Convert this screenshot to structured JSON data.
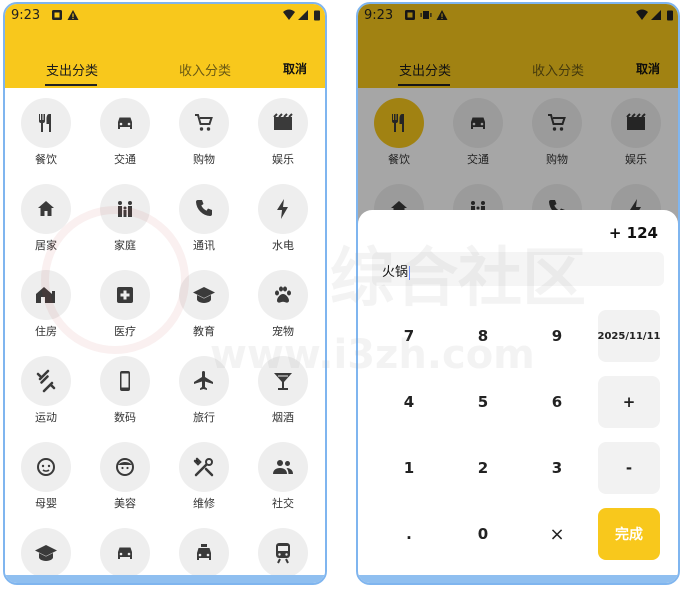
{
  "colors": {
    "accent": "#f8c81c",
    "phone_border": "#7fb5ef",
    "icon": "#3a3a3a",
    "circle_bg": "#eeeeee"
  },
  "status_bar": {
    "time": "9:23"
  },
  "tabs": {
    "expense": "支出分类",
    "income": "收入分类",
    "cancel": "取消"
  },
  "categories": [
    {
      "label": "餐饮",
      "icon": "restaurant-icon"
    },
    {
      "label": "交通",
      "icon": "car-icon"
    },
    {
      "label": "购物",
      "icon": "cart-icon"
    },
    {
      "label": "娱乐",
      "icon": "movie-icon"
    },
    {
      "label": "居家",
      "icon": "home-icon"
    },
    {
      "label": "家庭",
      "icon": "family-icon"
    },
    {
      "label": "通讯",
      "icon": "phone-icon"
    },
    {
      "label": "水电",
      "icon": "bolt-icon"
    },
    {
      "label": "住房",
      "icon": "house-icon"
    },
    {
      "label": "医疗",
      "icon": "medical-icon"
    },
    {
      "label": "教育",
      "icon": "school-icon"
    },
    {
      "label": "宠物",
      "icon": "paw-icon"
    },
    {
      "label": "运动",
      "icon": "fitness-icon"
    },
    {
      "label": "数码",
      "icon": "smartphone-icon"
    },
    {
      "label": "旅行",
      "icon": "airplane-icon"
    },
    {
      "label": "烟酒",
      "icon": "bar-icon"
    },
    {
      "label": "母婴",
      "icon": "baby-icon"
    },
    {
      "label": "美容",
      "icon": "face-icon"
    },
    {
      "label": "维修",
      "icon": "tools-icon"
    },
    {
      "label": "社交",
      "icon": "people-icon"
    },
    {
      "label": "",
      "icon": "school-icon"
    },
    {
      "label": "",
      "icon": "car-icon"
    },
    {
      "label": "",
      "icon": "taxi-icon"
    },
    {
      "label": "",
      "icon": "train-icon"
    }
  ],
  "entry": {
    "amount": "+ 124",
    "note": "火锅",
    "date": "2025/11/11",
    "keys": [
      "7",
      "8",
      "9",
      "4",
      "5",
      "6",
      "1",
      "2",
      "3",
      ".",
      "0",
      "×"
    ],
    "plus": "+",
    "minus": "-",
    "done": "完成"
  },
  "watermark": {
    "text_cn": "综合社区",
    "text_url": "www.i3zh.com"
  }
}
